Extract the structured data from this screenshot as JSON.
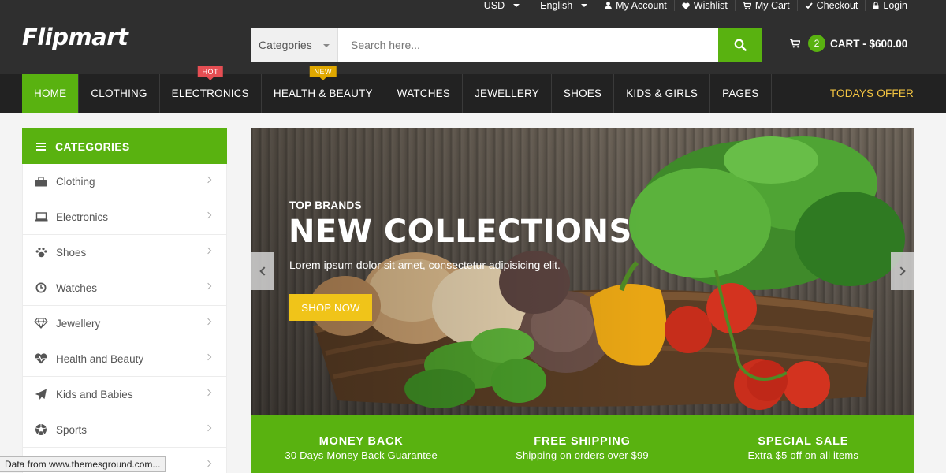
{
  "topbar": {
    "currency": "USD",
    "language": "English",
    "links": [
      {
        "label": "My Account",
        "icon": "user-icon"
      },
      {
        "label": "Wishlist",
        "icon": "heart-icon"
      },
      {
        "label": "My Cart",
        "icon": "cart-icon"
      },
      {
        "label": "Checkout",
        "icon": "check-icon"
      },
      {
        "label": "Login",
        "icon": "lock-icon"
      }
    ]
  },
  "logo": "Flipmart",
  "search": {
    "category_label": "Categories",
    "placeholder": "Search here..."
  },
  "cart": {
    "count": "2",
    "label": "CART - $600.00"
  },
  "nav": {
    "items": [
      {
        "label": "HOME",
        "active": true
      },
      {
        "label": "CLOTHING"
      },
      {
        "label": "ELECTRONICS",
        "badge": "HOT"
      },
      {
        "label": "HEALTH & BEAUTY",
        "badge": "NEW"
      },
      {
        "label": "WATCHES"
      },
      {
        "label": "JEWELLERY"
      },
      {
        "label": "SHOES"
      },
      {
        "label": "KIDS & GIRLS"
      },
      {
        "label": "PAGES"
      }
    ],
    "offer": "TODAYS OFFER"
  },
  "sidebar": {
    "title": "CATEGORIES",
    "items": [
      {
        "label": "Clothing",
        "icon": "shopping-bag-icon"
      },
      {
        "label": "Electronics",
        "icon": "laptop-icon"
      },
      {
        "label": "Shoes",
        "icon": "paw-icon"
      },
      {
        "label": "Watches",
        "icon": "clock-icon"
      },
      {
        "label": "Jewellery",
        "icon": "diamond-icon"
      },
      {
        "label": "Health and Beauty",
        "icon": "heartbeat-icon"
      },
      {
        "label": "Kids and Babies",
        "icon": "paper-plane-icon"
      },
      {
        "label": "Sports",
        "icon": "football-icon"
      },
      {
        "label": "",
        "icon": ""
      }
    ]
  },
  "banner": {
    "subtitle": "TOP BRANDS",
    "title": "NEW COLLECTIONS",
    "text": "Lorem ipsum dolor sit amet, consectetur adipisicing elit.",
    "button": "SHOP NOW"
  },
  "info": [
    {
      "title": "MONEY BACK",
      "subtitle": "30 Days Money Back Guarantee"
    },
    {
      "title": "FREE SHIPPING",
      "subtitle": "Shipping on orders over $99"
    },
    {
      "title": "SPECIAL SALE",
      "subtitle": "Extra $5 off on all items"
    }
  ],
  "status": "Data from www.themesground.com...",
  "colors": {
    "accent": "#59b210",
    "header_bg": "#2f2f2f",
    "nav_bg": "#222222",
    "offer": "#f4c542",
    "button_yellow": "#f0c419",
    "badge_hot": "#e54e53",
    "badge_new": "#e0a800"
  }
}
